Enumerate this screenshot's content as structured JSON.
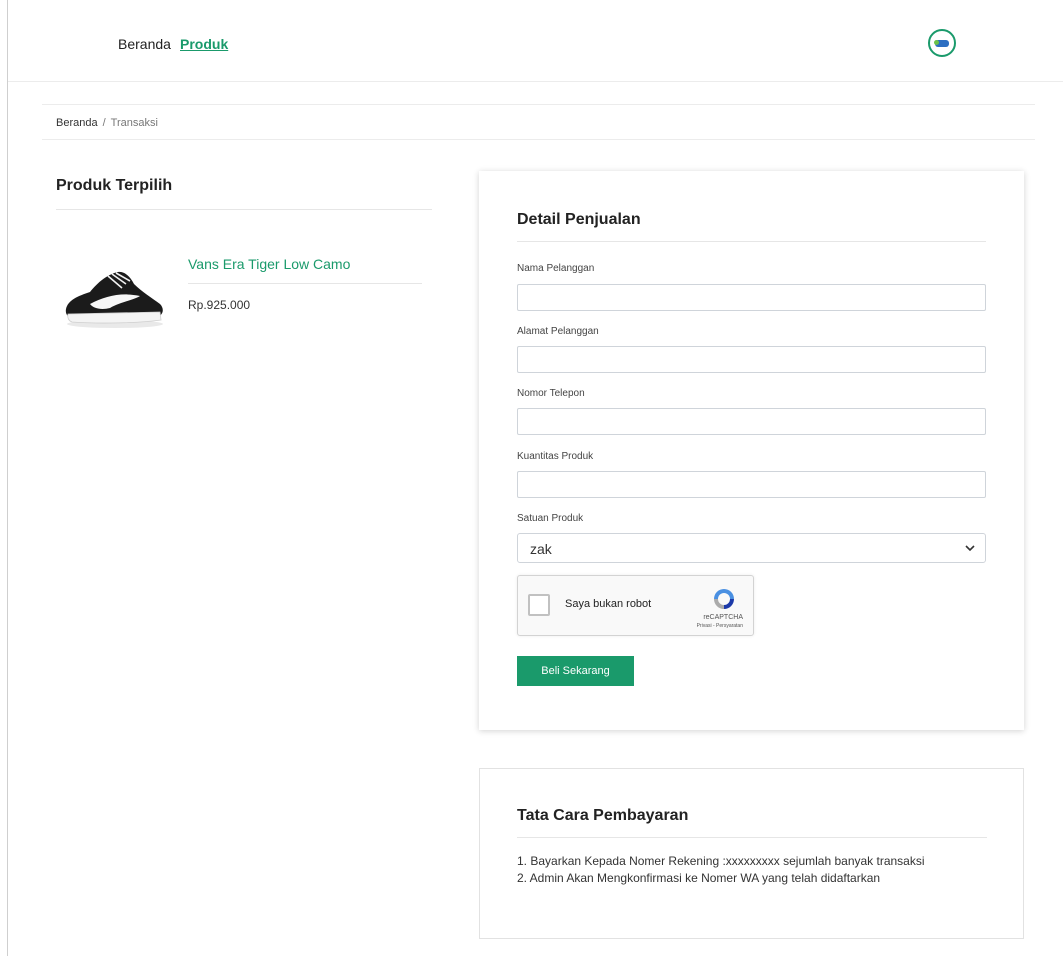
{
  "nav": {
    "home": "Beranda",
    "produk": "Produk"
  },
  "breadcrumb": {
    "home": "Beranda",
    "separator": "/",
    "current": "Transaksi"
  },
  "selected": {
    "title": "Produk Terpilih",
    "product_name": "Vans Era Tiger Low Camo",
    "product_price": "Rp.925.000",
    "image_icon": "sneaker-image"
  },
  "form": {
    "title": "Detail Penjualan",
    "fields": [
      {
        "label": "Nama Pelanggan",
        "value": ""
      },
      {
        "label": "Alamat Pelanggan",
        "value": ""
      },
      {
        "label": "Nomor Telepon",
        "value": ""
      },
      {
        "label": "Kuantitas Produk",
        "value": ""
      }
    ],
    "unit": {
      "label": "Satuan Produk",
      "value": "zak"
    },
    "captcha": {
      "label": "Saya bukan robot",
      "brand": "reCAPTCHA",
      "terms": "Privasi - Persyaratan"
    },
    "submit_label": "Beli Sekarang"
  },
  "payment": {
    "title": "Tata Cara Pembayaran",
    "steps": [
      "1. Bayarkan Kepada Nomer Rekening :xxxxxxxxx sejumlah banyak transaksi",
      "2. Admin Akan Mengkonfirmasi ke Nomer WA yang telah didaftarkan"
    ]
  },
  "colors": {
    "accent": "#1a9a6b",
    "text": "#333333",
    "border": "#cfd4da"
  }
}
